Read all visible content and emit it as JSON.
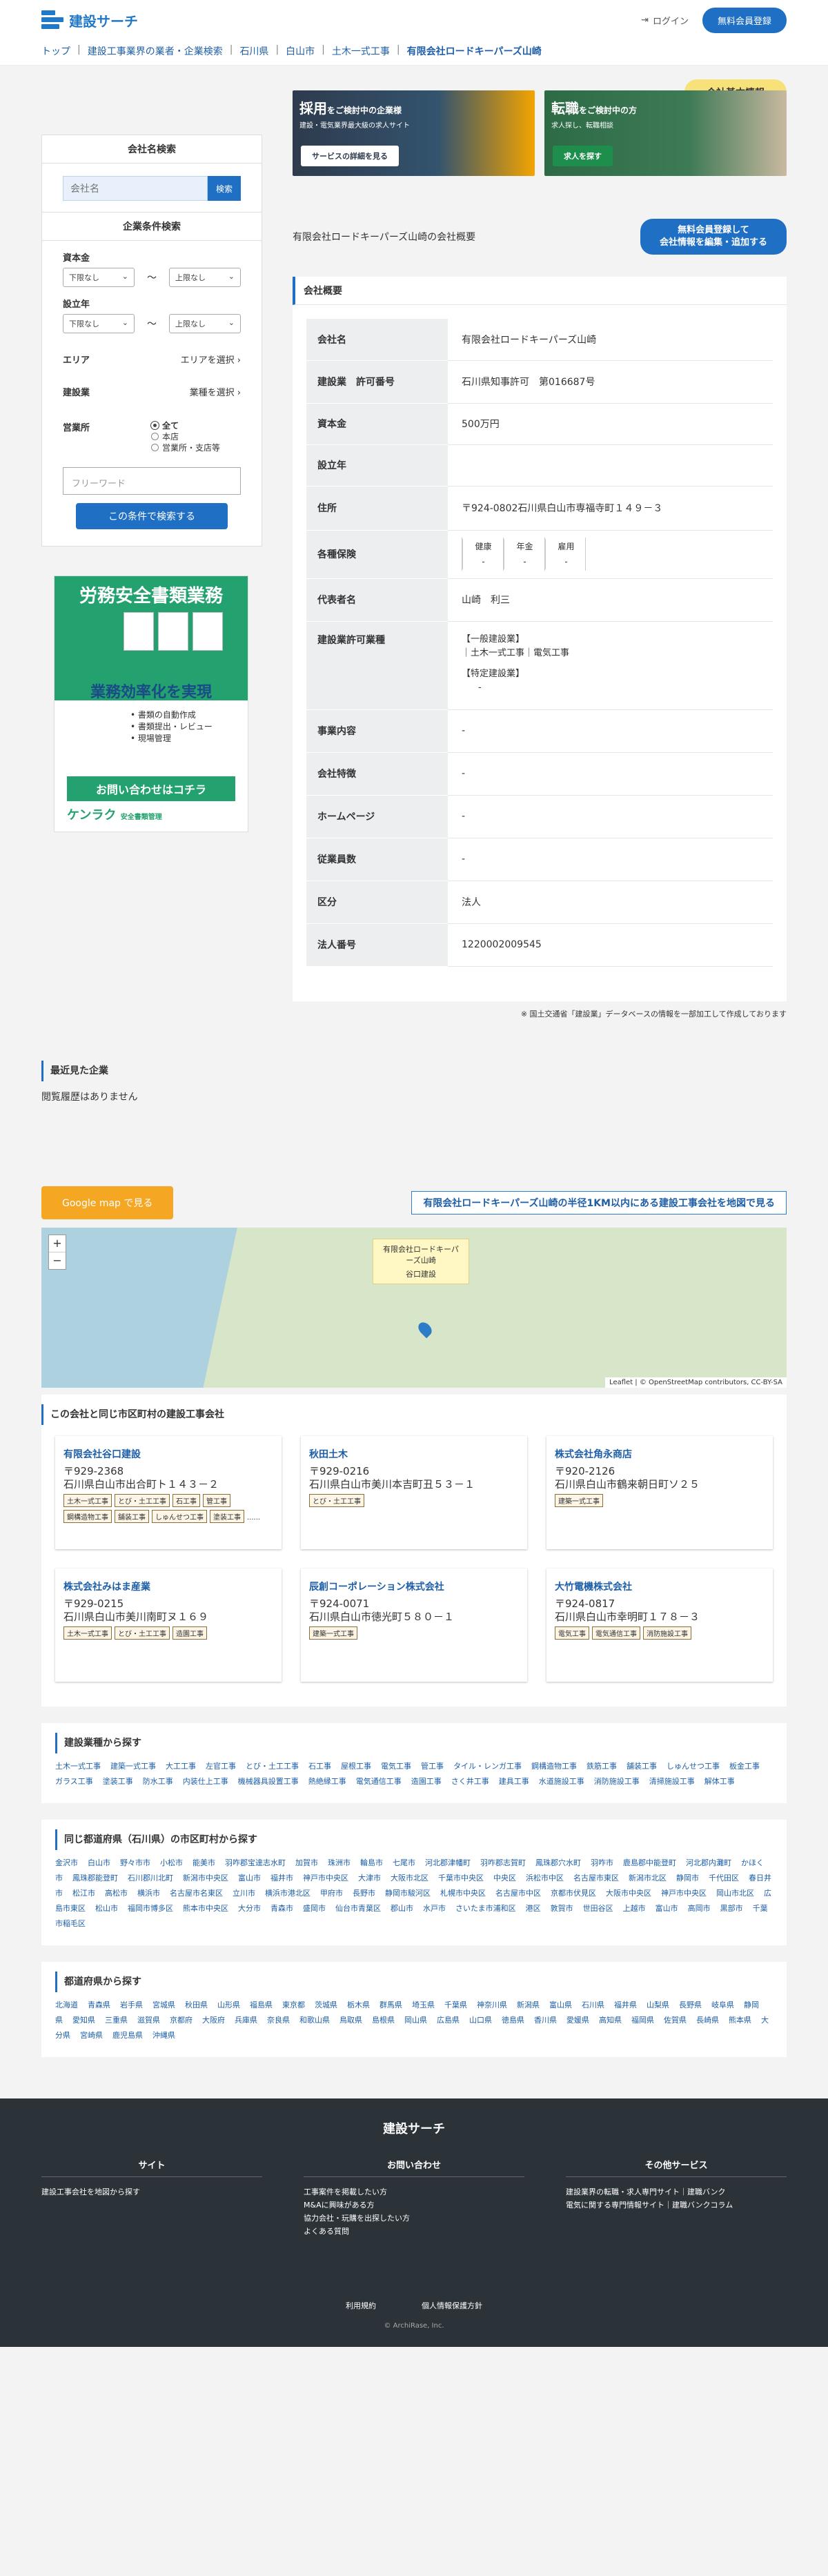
{
  "header": {
    "site_name": "建設サーチ",
    "login": "ログイン",
    "register": "無料会員登録"
  },
  "breadcrumb": [
    "トップ",
    "建設工事業界の業者・企業検索",
    "石川県",
    "白山市",
    "土木一式工事",
    "有限会社ロードキーパーズ山崎"
  ],
  "basic_badge": "会社基本情報",
  "sidebar": {
    "search_title": "会社名検索",
    "search_placeholder": "会社名",
    "search_button": "検索",
    "cond_title": "企業条件検索",
    "capital_label": "資本金",
    "from_label": "下限なし",
    "to_label": "上限なし",
    "tilde": "〜",
    "founded_label": "設立年",
    "area_label": "エリア",
    "area_value": "エリアを選択",
    "industry_label": "建設業",
    "industry_value": "業種を選択",
    "office_label": "営業所",
    "office_options": [
      "全て",
      "本店",
      "営業所・支店等"
    ],
    "free_placeholder": "フリーワード",
    "submit": "この条件で検索する"
  },
  "ad": {
    "title": "労務安全書類業務",
    "middle": "業務効率化を実現",
    "bullets": [
      "書類の自動作成",
      "書類提出・レビュー",
      "現場管理"
    ],
    "cta": "お問い合わせはコチラ",
    "brand": "ケンラク",
    "brand_sub": "安全書類管理"
  },
  "banners": [
    {
      "title_em": "採用",
      "title_rest": "をご検討中の企業様",
      "sub": "建設・電気業界最大級の求人サイト",
      "btn": "サービスの詳細を見る"
    },
    {
      "title_em": "転職",
      "title_rest": "をご検討中の方",
      "sub": "求人探し、転職相談",
      "btn": "求人を探す"
    }
  ],
  "overview": {
    "heading": "有限会社ロードキーパーズ山崎の会社概要",
    "edit_btn_1": "無料会員登録して",
    "edit_btn_2": "会社情報を編集・追加する",
    "card_title": "会社概要"
  },
  "info": {
    "name_label": "会社名",
    "name": "有限会社ロードキーパーズ山崎",
    "license_label": "建設業　許可番号",
    "license": "石川県知事許可　第016687号",
    "capital_label": "資本金",
    "capital": "500万円",
    "founded_label": "設立年",
    "founded": "",
    "address_label": "住所",
    "address": "〒924-0802石川県白山市専福寺町１４９－３",
    "insurance_label": "各種保険",
    "ins_health": "健康",
    "ins_pension": "年金",
    "ins_employ": "雇用",
    "ins_dash": "-",
    "rep_label": "代表者名",
    "rep": "山崎　利三",
    "permit_label": "建設業許可業種",
    "permit_general": "【一般建設業】",
    "permit_general_v": "土木一式工事｜電気工事",
    "permit_special": "【特定建設業】",
    "permit_special_v": "-",
    "business_label": "事業内容",
    "business": "-",
    "feature_label": "会社特徴",
    "feature": "-",
    "homepage_label": "ホームページ",
    "homepage": "-",
    "employees_label": "従業員数",
    "employees": "-",
    "type_label": "区分",
    "type": "法人",
    "corp_label": "法人番号",
    "corp": "1220002009545"
  },
  "note": "※ 国土交通省「建設業」データベースの情報を一部加工して作成しております",
  "recent": {
    "title": "最近見た企業",
    "empty": "閲覧履歴はありません"
  },
  "map": {
    "gm_btn": "Google map で見る",
    "link": "有限会社ロードキーパーズ山崎の半径1KM以内にある建設工事会社を地図で見る",
    "popup": "有限会社ロードキーパーズ山崎",
    "popup2": "谷口建設",
    "attr": "Leaflet | © OpenStreetMap contributors, CC-BY-SA"
  },
  "nearby": {
    "title": "この会社と同じ市区町村の建設工事会社",
    "companies": [
      {
        "name": "有限会社谷口建設",
        "zip": "〒929-2368",
        "addr": "石川県白山市出合町ト１４３－２",
        "tags": [
          "土木一式工事",
          "とび・土工工事",
          "石工事",
          "管工事",
          "鋼構造物工事",
          "舗装工事",
          "しゅんせつ工事",
          "塗装工事"
        ],
        "more": "......"
      },
      {
        "name": "秋田土木",
        "zip": "〒929-0216",
        "addr": "石川県白山市美川本吉町丑５３－１",
        "tags": [
          "とび・土工工事"
        ],
        "more": ""
      },
      {
        "name": "株式会社角永商店",
        "zip": "〒920-2126",
        "addr": "石川県白山市鶴来朝日町ソ２５",
        "tags": [
          "建築一式工事"
        ],
        "more": ""
      },
      {
        "name": "株式会社みはま産業",
        "zip": "〒929-0215",
        "addr": "石川県白山市美川南町ヌ１６９",
        "tags": [
          "土木一式工事",
          "とび・土工工事",
          "造園工事"
        ],
        "more": ""
      },
      {
        "name": "辰創コーポレーション株式会社",
        "zip": "〒924-0071",
        "addr": "石川県白山市徳光町５８０－１",
        "tags": [
          "建築一式工事"
        ],
        "more": ""
      },
      {
        "name": "大竹電機株式会社",
        "zip": "〒924-0817",
        "addr": "石川県白山市幸明町１７８－３",
        "tags": [
          "電気工事",
          "電気通信工事",
          "消防施設工事"
        ],
        "more": ""
      }
    ]
  },
  "industry_links": {
    "title": "建設業種から探す",
    "items": [
      "土木一式工事",
      "建築一式工事",
      "大工工事",
      "左官工事",
      "とび・土工工事",
      "石工事",
      "屋根工事",
      "電気工事",
      "管工事",
      "タイル・レンガ工事",
      "鋼構造物工事",
      "鉄筋工事",
      "舗装工事",
      "しゅんせつ工事",
      "板金工事",
      "ガラス工事",
      "塗装工事",
      "防水工事",
      "内装仕上工事",
      "機械器具設置工事",
      "熱絶縁工事",
      "電気通信工事",
      "造園工事",
      "さく井工事",
      "建具工事",
      "水道施設工事",
      "消防施設工事",
      "清掃施設工事",
      "解体工事"
    ]
  },
  "city_links": {
    "title": "同じ都道府県（石川県）の市区町村から探す",
    "items": [
      "金沢市",
      "白山市",
      "野々市市",
      "小松市",
      "能美市",
      "羽咋郡宝達志水町",
      "加賀市",
      "珠洲市",
      "輪島市",
      "七尾市",
      "河北郡津幡町",
      "羽咋郡志賀町",
      "鳳珠郡穴水町",
      "羽咋市",
      "鹿島郡中能登町",
      "河北郡内灘町",
      "かほく市",
      "鳳珠郡能登町",
      "石川郡川北町",
      "新潟市中央区",
      "富山市",
      "福井市",
      "神戸市中央区",
      "大津市",
      "大阪市北区",
      "千葉市中央区",
      "中央区",
      "浜松市中区",
      "名古屋市東区",
      "新潟市北区",
      "静岡市",
      "千代田区",
      "春日井市",
      "松江市",
      "高松市",
      "横浜市",
      "名古屋市名東区",
      "立川市",
      "横浜市港北区",
      "甲府市",
      "長野市",
      "静岡市駿河区",
      "札幌市中央区",
      "名古屋市中区",
      "京都市伏見区",
      "大阪市中央区",
      "神戸市中央区",
      "岡山市北区",
      "広島市東区",
      "松山市",
      "福岡市博多区",
      "熊本市中央区",
      "大分市",
      "青森市",
      "盛岡市",
      "仙台市青葉区",
      "郡山市",
      "水戸市",
      "さいたま市浦和区",
      "港区",
      "敦賀市",
      "世田谷区",
      "上越市",
      "富山市",
      "高岡市",
      "黒部市",
      "千葉市稲毛区"
    ]
  },
  "prefs": {
    "title": "都道府県から探す",
    "items": [
      "北海道",
      "青森県",
      "岩手県",
      "宮城県",
      "秋田県",
      "山形県",
      "福島県",
      "東京都",
      "茨城県",
      "栃木県",
      "群馬県",
      "埼玉県",
      "千葉県",
      "神奈川県",
      "新潟県",
      "富山県",
      "石川県",
      "福井県",
      "山梨県",
      "長野県",
      "岐阜県",
      "静岡県",
      "愛知県",
      "三重県",
      "滋賀県",
      "京都府",
      "大阪府",
      "兵庫県",
      "奈良県",
      "和歌山県",
      "鳥取県",
      "島根県",
      "岡山県",
      "広島県",
      "山口県",
      "徳島県",
      "香川県",
      "愛媛県",
      "高知県",
      "福岡県",
      "佐賀県",
      "長崎県",
      "熊本県",
      "大分県",
      "宮崎県",
      "鹿児島県",
      "沖縄県"
    ]
  },
  "footer": {
    "brand": "建設サーチ",
    "col1_title": "サイト",
    "col1": [
      "建設工事会社を地図から探す"
    ],
    "col2_title": "お問い合わせ",
    "col2": [
      "工事案件を掲載したい方",
      "M&Aに興味がある方",
      "協力会社・玩購を出探したい方",
      "よくある質問"
    ],
    "col3_title": "その他サービス",
    "col3": [
      "建設業界の転職・求人専門サイト｜建職バンク",
      "電気に関する専門情報サイト｜建職バンクコラム"
    ],
    "terms": "利用規約",
    "privacy": "個人情報保護方針",
    "copyright": "© ArchiRase, Inc."
  },
  "colors": {
    "primary": "#1f6fc4",
    "badge": "#f7e27a",
    "map_btn": "#f5a623",
    "footer": "#2b3238"
  }
}
